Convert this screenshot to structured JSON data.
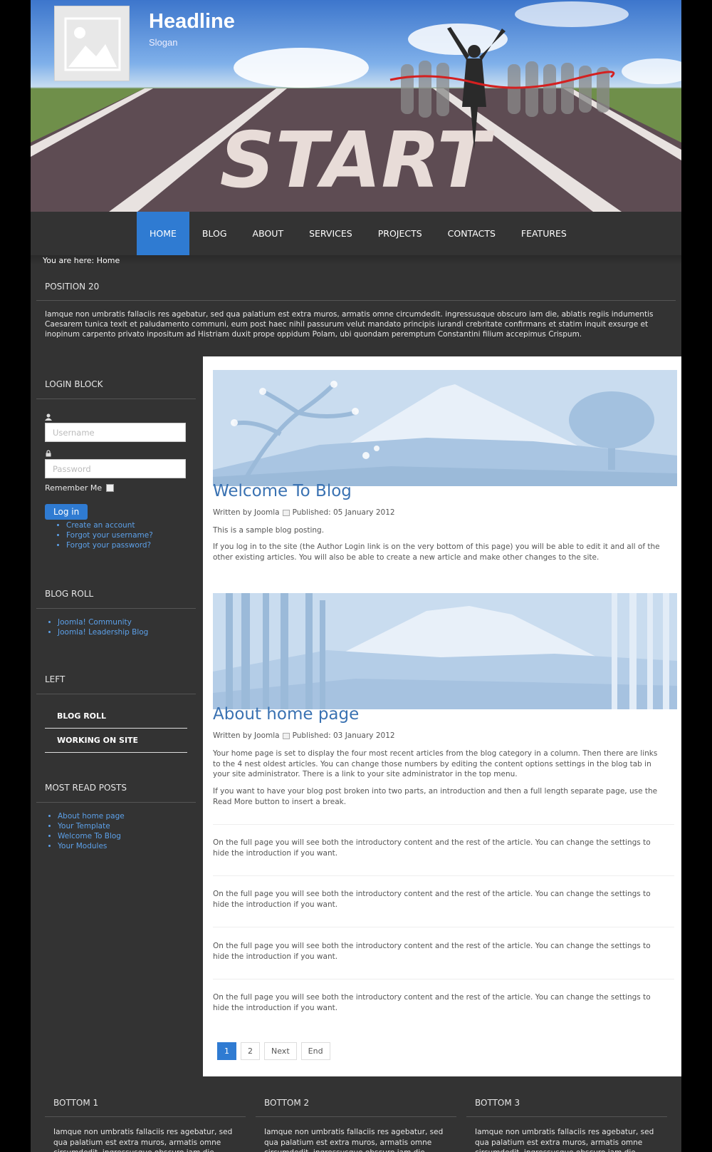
{
  "header": {
    "headline": "Headline",
    "slogan": "Slogan",
    "banner_word": "START"
  },
  "nav": {
    "items": [
      "HOME",
      "BLOG",
      "ABOUT",
      "SERVICES",
      "PROJECTS",
      "CONTACTS",
      "FEATURES"
    ],
    "active": "HOME"
  },
  "breadcrumb": {
    "prefix": "You are here:",
    "current": "Home"
  },
  "position20": {
    "title": "POSITION 20",
    "text": "Iamque non umbratis fallaciis res agebatur, sed qua palatium est extra muros, armatis omne circumdedit. ingressusque obscuro iam die, ablatis regiis indumentis Caesarem tunica texit et paludamento communi, eum post haec nihil passurum velut mandato principis iurandi crebritate confirmans et statim inquit exsurge et inopinum carpento privato inpositum ad Histriam duxit prope oppidum Polam, ubi quondam peremptum Constantini filium accepimus Crispum."
  },
  "login": {
    "title": "LOGIN BLOCK",
    "username_placeholder": "Username",
    "password_placeholder": "Password",
    "remember_label": "Remember Me",
    "login_button": "Log in",
    "links": [
      "Create an account",
      "Forgot your username?",
      "Forgot your password?"
    ]
  },
  "blogroll": {
    "title": "BLOG ROLL",
    "links": [
      "Joomla! Community",
      "Joomla! Leadership Blog"
    ]
  },
  "left": {
    "title": "LEFT",
    "items": [
      "BLOG ROLL",
      "WORKING ON SITE"
    ]
  },
  "mostread": {
    "title": "MOST READ POSTS",
    "links": [
      "About home page",
      "Your Template",
      "Welcome To Blog",
      "Your Modules"
    ]
  },
  "articles": [
    {
      "title": "Welcome To Blog",
      "written_by": "Written by Joomla",
      "published": "Published: 05 January 2012",
      "paragraphs": [
        "This is a sample blog posting.",
        "If you log in to the site (the Author Login link is on the very bottom of this page) you will be able to edit it and all of the other existing articles. You will also be able to create a new article and make other changes to the site."
      ]
    },
    {
      "title": "About home page",
      "written_by": "Written by Joomla",
      "published": "Published: 03 January 2012",
      "paragraphs": [
        "Your home page is set to display the four most recent articles from the blog category in a column. Then there are links to the 4 nest oldest articles. You can change those numbers by editing the content options settings in the blog tab in your site administrator. There is a link to your site administrator in the top menu.",
        "If you want to have your blog post broken into two parts, an introduction and then a full length separate page, use the Read More button to insert a break."
      ]
    }
  ],
  "intro_items": [
    "On the full page you will see both the introductory content and the rest of the article. You can change the settings to hide the introduction if you want.",
    "On the full page you will see both the introductory content and the rest of the article. You can change the settings to hide the introduction if you want.",
    "On the full page you will see both the introductory content and the rest of the article. You can change the settings to hide the introduction if you want.",
    "On the full page you will see both the introductory content and the rest of the article. You can change the settings to hide the introduction if you want."
  ],
  "pagination": {
    "pages": [
      "1",
      "2"
    ],
    "next": "Next",
    "end": "End",
    "current": "1"
  },
  "bottom": [
    {
      "title": "BOTTOM 1",
      "text": "Iamque non umbratis fallaciis res agebatur, sed qua palatium est extra muros, armatis omne circumdedit. ingressusque obscuro iam die, ablatis regiis"
    },
    {
      "title": "BOTTOM 2",
      "text": "Iamque non umbratis fallaciis res agebatur, sed qua palatium est extra muros, armatis omne circumdedit. ingressusque obscuro iam die, ablatis regiis"
    },
    {
      "title": "BOTTOM 3",
      "text": "Iamque non umbratis fallaciis res agebatur, sed qua palatium est extra muros, armatis omne circumdedit. ingressusque obscuro iam die, ablatis regiis"
    }
  ],
  "colors": {
    "accent": "#2f7bd2",
    "title_blue": "#3a72b2",
    "panel": "#333333"
  }
}
